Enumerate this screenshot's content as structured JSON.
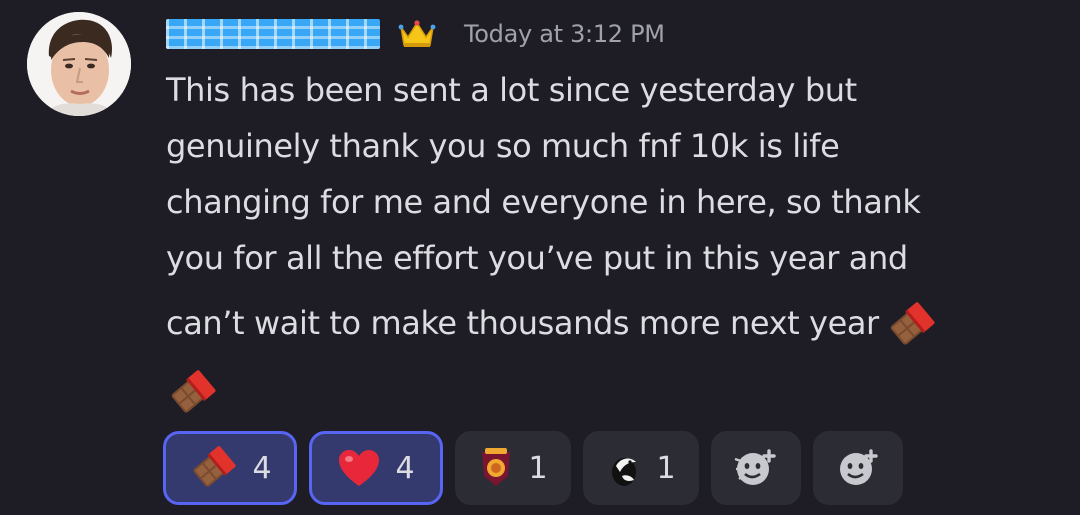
{
  "message": {
    "author_name": "",
    "author_badge": "crown-icon",
    "timestamp": "Today at 3:12 PM",
    "lines": [
      "This has been sent a lot since yesterday but",
      "genuinely thank you so much fnf 10k is life",
      "changing for me and everyone in here, so thank",
      "you for all the effort you’ve put in this year and",
      "can’t wait to make thousands more next year"
    ],
    "trailing_emojis": [
      "chocolate-bar",
      "chocolate-bar"
    ]
  },
  "reactions": [
    {
      "emoji": "chocolate-bar",
      "count": "4",
      "active": true
    },
    {
      "emoji": "red-heart",
      "count": "4",
      "active": true
    },
    {
      "emoji": "lions-logo",
      "count": "1",
      "active": false
    },
    {
      "emoji": "magpie-logo",
      "count": "1",
      "active": false
    },
    {
      "emoji": "add-super-reaction",
      "count": "",
      "active": false
    },
    {
      "emoji": "add-reaction",
      "count": "",
      "active": false
    }
  ],
  "colors": {
    "background": "#1e1d26",
    "text": "#dcdde2",
    "timestamp": "#a0a2a9",
    "username": "#38a7f5",
    "active_reaction_border": "#5864f2",
    "active_reaction_bg": "#353a6e",
    "reaction_bg": "#2c2c35"
  }
}
